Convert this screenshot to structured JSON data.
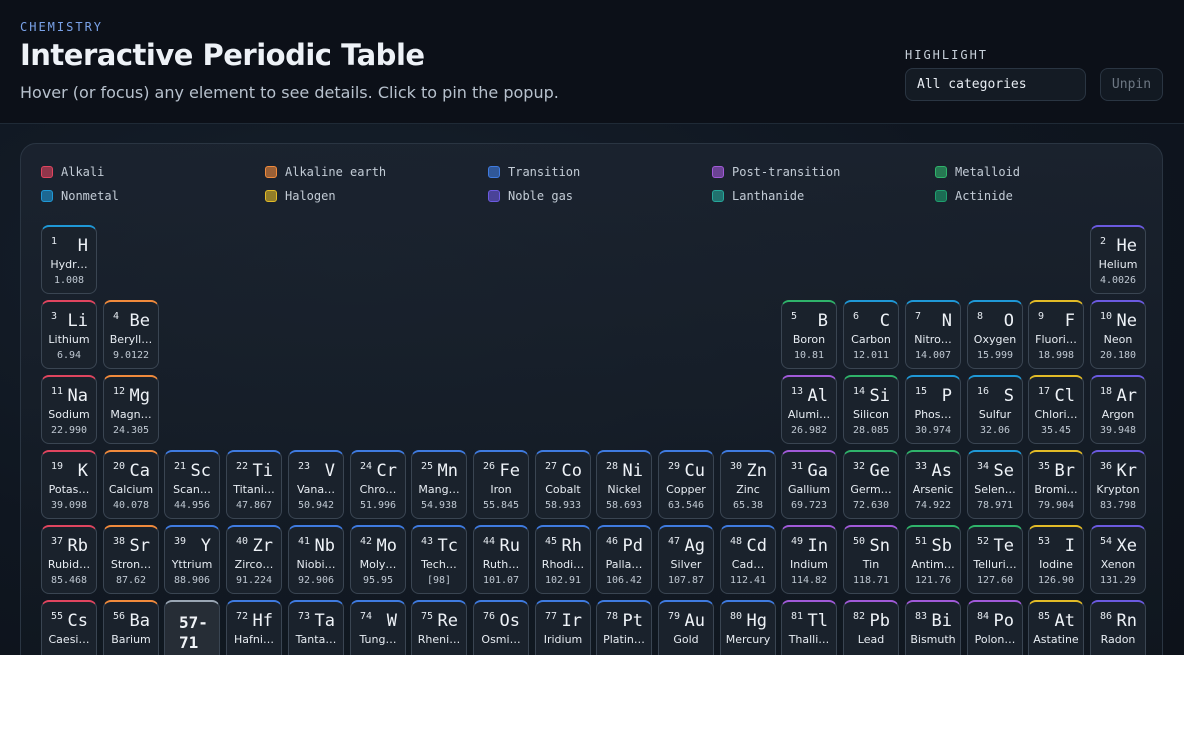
{
  "header": {
    "eyebrow": "CHEMISTRY",
    "title": "Interactive Periodic Table",
    "subtitle": "Hover (or focus) any element to see details. Click to pin the popup.",
    "highlight_label": "HIGHLIGHT",
    "highlight_value": "All categories",
    "unpin_label": "Unpin"
  },
  "legend": [
    {
      "key": "alkali",
      "label": "Alkali"
    },
    {
      "key": "alkaline",
      "label": "Alkaline earth"
    },
    {
      "key": "transition",
      "label": "Transition"
    },
    {
      "key": "post",
      "label": "Post-transition"
    },
    {
      "key": "metalloid",
      "label": "Metalloid"
    },
    {
      "key": "nonmetal",
      "label": "Nonmetal"
    },
    {
      "key": "halogen",
      "label": "Halogen"
    },
    {
      "key": "noble",
      "label": "Noble gas"
    },
    {
      "key": "lanthanide",
      "label": "Lanthanide"
    },
    {
      "key": "actinide",
      "label": "Actinide"
    }
  ],
  "colors": {
    "alkali": "#e0455f",
    "alkaline": "#f08a3c",
    "transition": "#3f7be0",
    "post": "#a15ad9",
    "metalloid": "#2fb36a",
    "nonmetal": "#1f98d6",
    "halogen": "#e2bb27",
    "noble": "#6b5ae0",
    "lanthanide": "#26a69a",
    "actinide": "#1e9f6e",
    "range": "#9aa6b4"
  },
  "elements": [
    {
      "n": "1",
      "s": "H",
      "name": "Hydr…",
      "w": "1.008",
      "cat": "nonmetal",
      "row": 1,
      "col": 1
    },
    {
      "n": "2",
      "s": "He",
      "name": "Helium",
      "w": "4.0026",
      "cat": "noble",
      "row": 1,
      "col": 18
    },
    {
      "n": "3",
      "s": "Li",
      "name": "Lithium",
      "w": "6.94",
      "cat": "alkali",
      "row": 2,
      "col": 1
    },
    {
      "n": "4",
      "s": "Be",
      "name": "Beryll…",
      "w": "9.0122",
      "cat": "alkaline",
      "row": 2,
      "col": 2
    },
    {
      "n": "5",
      "s": "B",
      "name": "Boron",
      "w": "10.81",
      "cat": "metalloid",
      "row": 2,
      "col": 13
    },
    {
      "n": "6",
      "s": "C",
      "name": "Carbon",
      "w": "12.011",
      "cat": "nonmetal",
      "row": 2,
      "col": 14
    },
    {
      "n": "7",
      "s": "N",
      "name": "Nitro…",
      "w": "14.007",
      "cat": "nonmetal",
      "row": 2,
      "col": 15
    },
    {
      "n": "8",
      "s": "O",
      "name": "Oxygen",
      "w": "15.999",
      "cat": "nonmetal",
      "row": 2,
      "col": 16
    },
    {
      "n": "9",
      "s": "F",
      "name": "Fluori…",
      "w": "18.998",
      "cat": "halogen",
      "row": 2,
      "col": 17
    },
    {
      "n": "10",
      "s": "Ne",
      "name": "Neon",
      "w": "20.180",
      "cat": "noble",
      "row": 2,
      "col": 18
    },
    {
      "n": "11",
      "s": "Na",
      "name": "Sodium",
      "w": "22.990",
      "cat": "alkali",
      "row": 3,
      "col": 1
    },
    {
      "n": "12",
      "s": "Mg",
      "name": "Magn…",
      "w": "24.305",
      "cat": "alkaline",
      "row": 3,
      "col": 2
    },
    {
      "n": "13",
      "s": "Al",
      "name": "Alumi…",
      "w": "26.982",
      "cat": "post",
      "row": 3,
      "col": 13
    },
    {
      "n": "14",
      "s": "Si",
      "name": "Silicon",
      "w": "28.085",
      "cat": "metalloid",
      "row": 3,
      "col": 14
    },
    {
      "n": "15",
      "s": "P",
      "name": "Phos…",
      "w": "30.974",
      "cat": "nonmetal",
      "row": 3,
      "col": 15
    },
    {
      "n": "16",
      "s": "S",
      "name": "Sulfur",
      "w": "32.06",
      "cat": "nonmetal",
      "row": 3,
      "col": 16
    },
    {
      "n": "17",
      "s": "Cl",
      "name": "Chlori…",
      "w": "35.45",
      "cat": "halogen",
      "row": 3,
      "col": 17
    },
    {
      "n": "18",
      "s": "Ar",
      "name": "Argon",
      "w": "39.948",
      "cat": "noble",
      "row": 3,
      "col": 18
    },
    {
      "n": "19",
      "s": "K",
      "name": "Potas…",
      "w": "39.098",
      "cat": "alkali",
      "row": 4,
      "col": 1
    },
    {
      "n": "20",
      "s": "Ca",
      "name": "Calcium",
      "w": "40.078",
      "cat": "alkaline",
      "row": 4,
      "col": 2
    },
    {
      "n": "21",
      "s": "Sc",
      "name": "Scan…",
      "w": "44.956",
      "cat": "transition",
      "row": 4,
      "col": 3
    },
    {
      "n": "22",
      "s": "Ti",
      "name": "Titani…",
      "w": "47.867",
      "cat": "transition",
      "row": 4,
      "col": 4
    },
    {
      "n": "23",
      "s": "V",
      "name": "Vana…",
      "w": "50.942",
      "cat": "transition",
      "row": 4,
      "col": 5
    },
    {
      "n": "24",
      "s": "Cr",
      "name": "Chro…",
      "w": "51.996",
      "cat": "transition",
      "row": 4,
      "col": 6
    },
    {
      "n": "25",
      "s": "Mn",
      "name": "Mang…",
      "w": "54.938",
      "cat": "transition",
      "row": 4,
      "col": 7
    },
    {
      "n": "26",
      "s": "Fe",
      "name": "Iron",
      "w": "55.845",
      "cat": "transition",
      "row": 4,
      "col": 8
    },
    {
      "n": "27",
      "s": "Co",
      "name": "Cobalt",
      "w": "58.933",
      "cat": "transition",
      "row": 4,
      "col": 9
    },
    {
      "n": "28",
      "s": "Ni",
      "name": "Nickel",
      "w": "58.693",
      "cat": "transition",
      "row": 4,
      "col": 10
    },
    {
      "n": "29",
      "s": "Cu",
      "name": "Copper",
      "w": "63.546",
      "cat": "transition",
      "row": 4,
      "col": 11
    },
    {
      "n": "30",
      "s": "Zn",
      "name": "Zinc",
      "w": "65.38",
      "cat": "transition",
      "row": 4,
      "col": 12
    },
    {
      "n": "31",
      "s": "Ga",
      "name": "Gallium",
      "w": "69.723",
      "cat": "post",
      "row": 4,
      "col": 13
    },
    {
      "n": "32",
      "s": "Ge",
      "name": "Germ…",
      "w": "72.630",
      "cat": "metalloid",
      "row": 4,
      "col": 14
    },
    {
      "n": "33",
      "s": "As",
      "name": "Arsenic",
      "w": "74.922",
      "cat": "metalloid",
      "row": 4,
      "col": 15
    },
    {
      "n": "34",
      "s": "Se",
      "name": "Selen…",
      "w": "78.971",
      "cat": "nonmetal",
      "row": 4,
      "col": 16
    },
    {
      "n": "35",
      "s": "Br",
      "name": "Bromi…",
      "w": "79.904",
      "cat": "halogen",
      "row": 4,
      "col": 17
    },
    {
      "n": "36",
      "s": "Kr",
      "name": "Krypton",
      "w": "83.798",
      "cat": "noble",
      "row": 4,
      "col": 18
    },
    {
      "n": "37",
      "s": "Rb",
      "name": "Rubid…",
      "w": "85.468",
      "cat": "alkali",
      "row": 5,
      "col": 1
    },
    {
      "n": "38",
      "s": "Sr",
      "name": "Stron…",
      "w": "87.62",
      "cat": "alkaline",
      "row": 5,
      "col": 2
    },
    {
      "n": "39",
      "s": "Y",
      "name": "Yttrium",
      "w": "88.906",
      "cat": "transition",
      "row": 5,
      "col": 3
    },
    {
      "n": "40",
      "s": "Zr",
      "name": "Zirco…",
      "w": "91.224",
      "cat": "transition",
      "row": 5,
      "col": 4
    },
    {
      "n": "41",
      "s": "Nb",
      "name": "Niobi…",
      "w": "92.906",
      "cat": "transition",
      "row": 5,
      "col": 5
    },
    {
      "n": "42",
      "s": "Mo",
      "name": "Moly…",
      "w": "95.95",
      "cat": "transition",
      "row": 5,
      "col": 6
    },
    {
      "n": "43",
      "s": "Tc",
      "name": "Tech…",
      "w": "[98]",
      "cat": "transition",
      "row": 5,
      "col": 7
    },
    {
      "n": "44",
      "s": "Ru",
      "name": "Ruth…",
      "w": "101.07",
      "cat": "transition",
      "row": 5,
      "col": 8
    },
    {
      "n": "45",
      "s": "Rh",
      "name": "Rhodi…",
      "w": "102.91",
      "cat": "transition",
      "row": 5,
      "col": 9
    },
    {
      "n": "46",
      "s": "Pd",
      "name": "Palla…",
      "w": "106.42",
      "cat": "transition",
      "row": 5,
      "col": 10
    },
    {
      "n": "47",
      "s": "Ag",
      "name": "Silver",
      "w": "107.87",
      "cat": "transition",
      "row": 5,
      "col": 11
    },
    {
      "n": "48",
      "s": "Cd",
      "name": "Cad…",
      "w": "112.41",
      "cat": "transition",
      "row": 5,
      "col": 12
    },
    {
      "n": "49",
      "s": "In",
      "name": "Indium",
      "w": "114.82",
      "cat": "post",
      "row": 5,
      "col": 13
    },
    {
      "n": "50",
      "s": "Sn",
      "name": "Tin",
      "w": "118.71",
      "cat": "post",
      "row": 5,
      "col": 14
    },
    {
      "n": "51",
      "s": "Sb",
      "name": "Antim…",
      "w": "121.76",
      "cat": "metalloid",
      "row": 5,
      "col": 15
    },
    {
      "n": "52",
      "s": "Te",
      "name": "Telluri…",
      "w": "127.60",
      "cat": "metalloid",
      "row": 5,
      "col": 16
    },
    {
      "n": "53",
      "s": "I",
      "name": "Iodine",
      "w": "126.90",
      "cat": "halogen",
      "row": 5,
      "col": 17
    },
    {
      "n": "54",
      "s": "Xe",
      "name": "Xenon",
      "w": "131.29",
      "cat": "noble",
      "row": 5,
      "col": 18
    },
    {
      "n": "55",
      "s": "Cs",
      "name": "Caesi…",
      "w": "",
      "cat": "alkali",
      "row": 6,
      "col": 1
    },
    {
      "n": "56",
      "s": "Ba",
      "name": "Barium",
      "w": "",
      "cat": "alkaline",
      "row": 6,
      "col": 2
    },
    {
      "range": "57-\n71",
      "cat": "range",
      "row": 6,
      "col": 3
    },
    {
      "n": "72",
      "s": "Hf",
      "name": "Hafni…",
      "w": "",
      "cat": "transition",
      "row": 6,
      "col": 4
    },
    {
      "n": "73",
      "s": "Ta",
      "name": "Tanta…",
      "w": "",
      "cat": "transition",
      "row": 6,
      "col": 5
    },
    {
      "n": "74",
      "s": "W",
      "name": "Tung…",
      "w": "",
      "cat": "transition",
      "row": 6,
      "col": 6
    },
    {
      "n": "75",
      "s": "Re",
      "name": "Rheni…",
      "w": "",
      "cat": "transition",
      "row": 6,
      "col": 7
    },
    {
      "n": "76",
      "s": "Os",
      "name": "Osmi…",
      "w": "",
      "cat": "transition",
      "row": 6,
      "col": 8
    },
    {
      "n": "77",
      "s": "Ir",
      "name": "Iridium",
      "w": "",
      "cat": "transition",
      "row": 6,
      "col": 9
    },
    {
      "n": "78",
      "s": "Pt",
      "name": "Platin…",
      "w": "",
      "cat": "transition",
      "row": 6,
      "col": 10
    },
    {
      "n": "79",
      "s": "Au",
      "name": "Gold",
      "w": "",
      "cat": "transition",
      "row": 6,
      "col": 11
    },
    {
      "n": "80",
      "s": "Hg",
      "name": "Mercury",
      "w": "",
      "cat": "transition",
      "row": 6,
      "col": 12
    },
    {
      "n": "81",
      "s": "Tl",
      "name": "Thalli…",
      "w": "",
      "cat": "post",
      "row": 6,
      "col": 13
    },
    {
      "n": "82",
      "s": "Pb",
      "name": "Lead",
      "w": "",
      "cat": "post",
      "row": 6,
      "col": 14
    },
    {
      "n": "83",
      "s": "Bi",
      "name": "Bismuth",
      "w": "",
      "cat": "post",
      "row": 6,
      "col": 15
    },
    {
      "n": "84",
      "s": "Po",
      "name": "Polon…",
      "w": "",
      "cat": "post",
      "row": 6,
      "col": 16
    },
    {
      "n": "85",
      "s": "At",
      "name": "Astatine",
      "w": "",
      "cat": "halogen",
      "row": 6,
      "col": 17
    },
    {
      "n": "86",
      "s": "Rn",
      "name": "Radon",
      "w": "",
      "cat": "noble",
      "row": 6,
      "col": 18
    }
  ]
}
